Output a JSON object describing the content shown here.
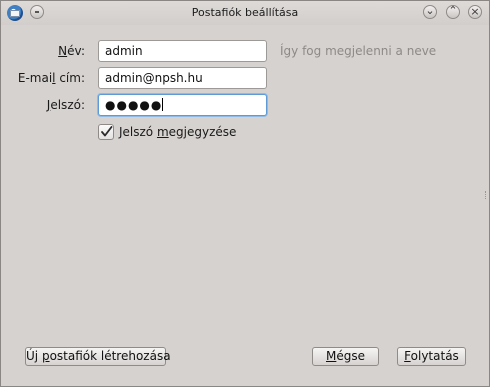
{
  "window": {
    "title": "Postafiók beállítása"
  },
  "form": {
    "name": {
      "label": "Név:",
      "label_parts": [
        "N",
        "év:"
      ],
      "value": "admin",
      "hint": "Így fog megjelenni a neve"
    },
    "email": {
      "label": "E-mail cím:",
      "label_parts": [
        "E-mai",
        "l",
        " cím:"
      ],
      "value": "admin@npsh.hu"
    },
    "password": {
      "label": "Jelszó:",
      "label_parts": [
        "J",
        "elszó:"
      ],
      "masked_value": "●●●●●"
    },
    "remember": {
      "label": "Jelszó megjegyzése",
      "label_parts": [
        "Jelszó ",
        "m",
        "egjegyzése"
      ],
      "checked": true
    }
  },
  "buttons": {
    "new_account": {
      "label": "Új postafiók létrehozása",
      "label_parts": [
        "Új ",
        "p",
        "ostafiók létrehozása"
      ]
    },
    "cancel": {
      "label": "Mégse",
      "label_parts": [
        "",
        "M",
        "égse"
      ]
    },
    "continue": {
      "label": "Folytatás",
      "label_parts": [
        "",
        "F",
        "olytatás"
      ]
    }
  },
  "icons": {
    "app": "thunderbird-app-icon",
    "window_menu": "window-menu-icon",
    "minimize": "minimize-icon",
    "maximize": "maximize-icon",
    "close": "close-icon",
    "checkmark": "checkmark-icon"
  }
}
